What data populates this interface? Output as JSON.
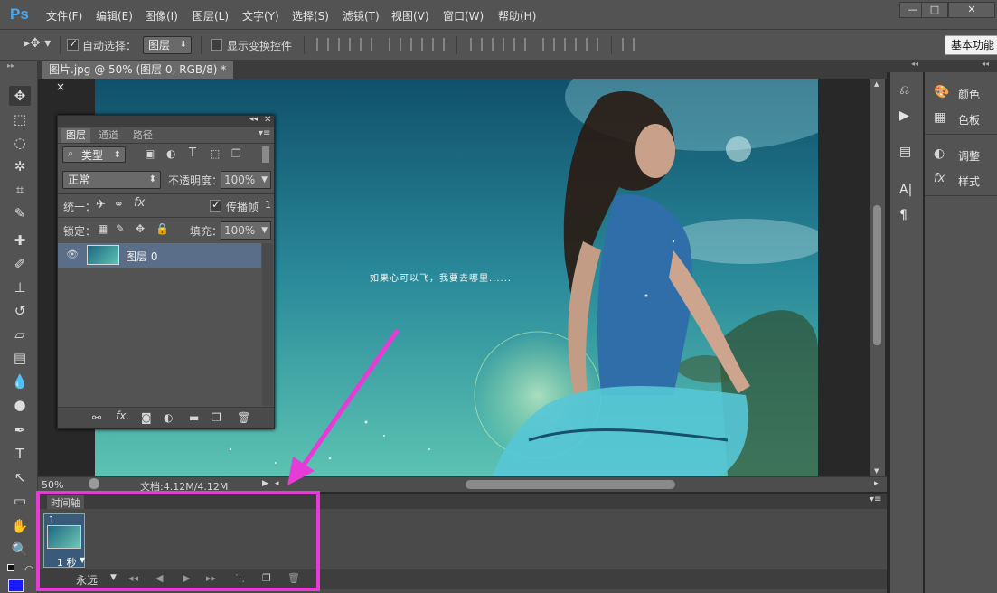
{
  "app": {
    "logo": "Ps"
  },
  "menu": [
    "文件(F)",
    "编辑(E)",
    "图像(I)",
    "图层(L)",
    "文字(Y)",
    "选择(S)",
    "滤镜(T)",
    "视图(V)",
    "窗口(W)",
    "帮助(H)"
  ],
  "window_controls": {
    "minimize": "—",
    "maximize": "□",
    "close": "✕"
  },
  "options": {
    "auto_select_label": "自动选择：",
    "auto_select_value": "图层",
    "show_transform_label": "显示变换控件",
    "workspace": "基本功能"
  },
  "document": {
    "tab_title": "图片.jpg @ 50% (图层 0, RGB/8) *",
    "tab_close": "×",
    "canvas_text": "如果心可以飞，我要去哪里......",
    "zoom": "50%",
    "doc_info": "文档:4.12M/4.12M"
  },
  "layers_panel": {
    "tabs": [
      "图层",
      "通道",
      "路径"
    ],
    "filter_type": "类型",
    "blend_mode": "正常",
    "opacity_label": "不透明度：",
    "opacity_value": "100%",
    "unify_label": "统一：",
    "propagate_label": "传播帧",
    "propagate_value": "1",
    "lock_label": "锁定：",
    "fill_label": "填充：",
    "fill_value": "100%",
    "layer_name": "图层 0"
  },
  "timeline": {
    "title": "时间轴",
    "frame_number": "1",
    "frame_delay": "1 秒",
    "loop": "永远"
  },
  "right_panels": {
    "items": [
      "颜色",
      "色板",
      "调整",
      "样式"
    ]
  },
  "colors": {
    "accent_magenta": "#e63bd7",
    "ps_blue": "#4aa8f0",
    "foreground": "#1a1aff"
  }
}
